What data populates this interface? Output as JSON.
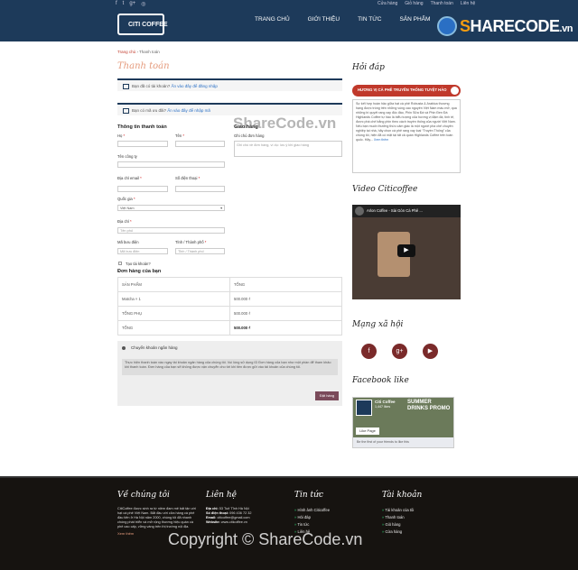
{
  "topbar": {
    "social_icons": [
      "facebook-icon",
      "twitter-icon",
      "google-plus-icon",
      "instagram-icon"
    ],
    "links": [
      "Cửa hàng",
      "Giỏ hàng",
      "Thanh toán",
      "Liên hệ"
    ]
  },
  "header": {
    "logo_text": "CITI COFFEE",
    "menu": [
      "TRANG CHỦ",
      "GIỚI THIỆU",
      "TIN TỨC",
      "SẢN PHẨM"
    ],
    "watermark_logo": "SHARECODE.vn"
  },
  "breadcrumb": {
    "home": "Trang chủ",
    "current": "Thanh toán"
  },
  "page_title": "Thanh toán",
  "notices": [
    {
      "text": "Bạn đã có tài khoản? ",
      "link": "Ấn vào đây để đăng nhập"
    },
    {
      "text": "Bạn có mã ưu đãi? ",
      "link": "Ấn vào đây để nhập mã"
    }
  ],
  "billing": {
    "heading": "Thông tin thanh toán",
    "first_name_label": "Họ",
    "last_name_label": "Tên",
    "company_label": "Tên công ty",
    "email_label": "Địa chỉ email",
    "phone_label": "Số điện thoại",
    "country_label": "Quốc gia",
    "country_value": "Việt Nam",
    "address_label": "Địa chỉ",
    "address_placeholder": "Tên phố",
    "postcode_label": "Mã bưu điện",
    "postcode_placeholder": "Mã bưu điện",
    "city_label": "Tỉnh / Thành phố",
    "city_placeholder": "Tỉnh / Thành phố",
    "create_account_label": "Tạo tài khoản?"
  },
  "shipping": {
    "heading": "Giao hàng",
    "notes_label": "Ghi chú đơn hàng",
    "notes_placeholder": "Ghi chú về đơn hàng, ví dụ: lưu ý khi giao hàng"
  },
  "order": {
    "heading": "Đơn hàng của bạn",
    "col_product": "SẢN PHẨM",
    "col_total": "TỔNG",
    "rows": [
      {
        "product": "Matcha × 1",
        "total": "500.000 ₫",
        "bold": false
      },
      {
        "product": "TỔNG PHỤ",
        "total": "500.000 ₫",
        "bold": false
      },
      {
        "product": "TỔNG",
        "total": "500.000 ₫",
        "bold": true
      }
    ]
  },
  "payment": {
    "method": "Chuyển khoản ngân hàng",
    "description": "Thực hiện thanh toán vào ngay tài khoản ngân hàng của chúng tôi. Vui lòng sử dụng ID Đơn hàng của bạn như một phần để tham khảo khi thanh toán. Đơn hàng của bạn sẽ không được vận chuyển cho tới khi tiền được gửi vào tài khoản của chúng tôi.",
    "button": "Đặt hàng"
  },
  "sidebar": {
    "hoi_dap": "Hỏi đáp",
    "hot_title": "HƯƠNG VỊ CÀ PHÊ TRUYỀN THỐNG TUYỆT HẢO",
    "hot_text": "Sự kết hợp hoàn hảo giữa hạt cà phê Robusta & Arabica thượng hạng được trồng trên những vùng cao nguyên Việt Nam màu mỡ, qua những bí quyết rang xay độc đáo, Phin Sữa Đá và Phin Đen Đá Highlands Coffee tự hào là biểu tượng của hương vị đậm đà, tinh tế, được phá chế bằng phin theo cách truyền thống của người Việt Nam. Nếu bạn muốn thưởng thức cảm giác là một người pha chế chuyên nghiệp tại nhà, hãy chọn cà phê rang xay loại “Truyền Thống” của chúng tôi, hiện đã có mặt tại tất cả quán Highlands Coffee trên toàn quốc. Hãy...",
    "hot_more": "Xem thêm",
    "video_title": "Video Citicoffee",
    "video_caption": "Arlon Coffee - Sài Gòn Cà Phê ...",
    "social_title": "Mạng xã hội",
    "social_icons": [
      "facebook-icon",
      "google-plus-icon",
      "youtube-icon"
    ],
    "fb_title": "Facebook like",
    "fb_page": "Citi Coffee",
    "fb_likes": "1,447 likes",
    "fb_promo": "SUMMER DRINKS PROMO",
    "fb_like_btn": "Like Page",
    "fb_footer": "Be the first of your friends to like this"
  },
  "footer": {
    "about_title": "Về chúng tôi",
    "about_text": "CitiCoffee được sinh ra từ niềm đam mê bất tận với hạt cà phê Việt Nam. Bắt đầu với cửa hàng cà phê đầu tiên ở Hà Nội năm 2000, chúng tôi đã nhanh chóng phát triển và mở rộng thương hiệu quán cà phê cao cấp, vững vàng trên thị trường nội địa.",
    "about_more": "Xem thêm",
    "contact_title": "Liên hệ",
    "contact_address_label": "Địa chỉ:",
    "contact_address": "53 Tuệ Tĩnh Hà Nội",
    "contact_phone_label": "Số điện thoại:",
    "contact_phone": "096 436 72 32",
    "contact_email_label": "Email:",
    "contact_email": "citicoffee@gmail.com",
    "contact_web_label": "Website:",
    "contact_web": "www.citicoffee.vn",
    "news_title": "Tin tức",
    "news_links": [
      "Hình ảnh Citicoffee",
      "Hỏi đáp",
      "Tin tức",
      "Liên hệ"
    ],
    "account_title": "Tài khoản",
    "account_links": [
      "Tài khoản của tôi",
      "Thanh toán",
      "Giỏ hàng",
      "Cửa hàng"
    ],
    "copyright_watermark": "Copyright © ShareCode.vn"
  },
  "watermark_mid": "ShareCode.vn"
}
